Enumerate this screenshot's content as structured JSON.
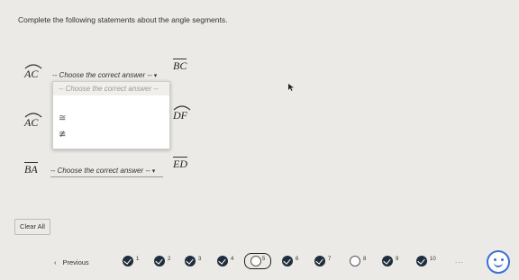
{
  "instruction": "Complete the following statements about the angle segments.",
  "statements": [
    {
      "left": "AC",
      "left_type": "arc",
      "select": "-- Choose the correct answer --",
      "right": "BC",
      "right_type": "segment"
    },
    {
      "left": "AC",
      "left_type": "arc",
      "select": "",
      "right": "DF",
      "right_type": "arc"
    },
    {
      "left": "BA",
      "left_type": "segment",
      "select": "-- Choose the correct answer --",
      "right": "ED",
      "right_type": "segment"
    }
  ],
  "dropdown": {
    "placeholder": "-- Choose the correct answer --",
    "options": [
      "≅",
      "≇"
    ]
  },
  "clear_label": "Clear All",
  "prev_label": "Previous",
  "prev_icon": "chevron-left-icon",
  "questions": [
    {
      "num": "1",
      "state": "done"
    },
    {
      "num": "2",
      "state": "done"
    },
    {
      "num": "3",
      "state": "done"
    },
    {
      "num": "4",
      "state": "done"
    },
    {
      "num": "5",
      "state": "current"
    },
    {
      "num": "6",
      "state": "done"
    },
    {
      "num": "7",
      "state": "done"
    },
    {
      "num": "8",
      "state": "open"
    },
    {
      "num": "9",
      "state": "done"
    },
    {
      "num": "10",
      "state": "done"
    }
  ],
  "more_label": "...",
  "colors": {
    "check": "#1f2d3d",
    "accent": "#3d6fd6",
    "background": "#eceae6"
  }
}
